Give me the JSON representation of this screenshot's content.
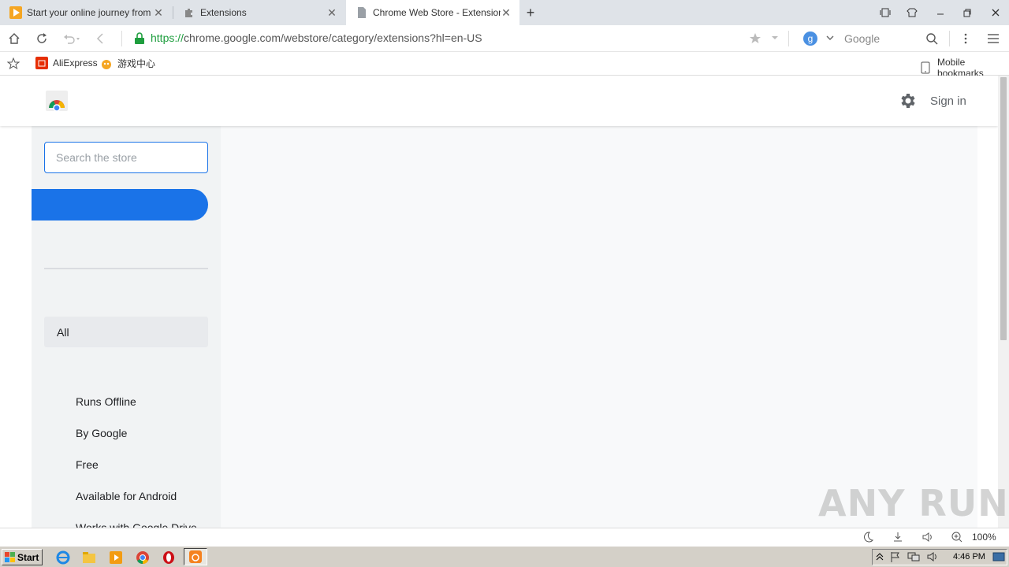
{
  "tabs": [
    {
      "title": "Start your online journey from he",
      "active": false
    },
    {
      "title": "Extensions",
      "active": false
    },
    {
      "title": "Chrome Web Store - Extensions",
      "active": true
    }
  ],
  "address": {
    "url_scheme": "https://",
    "url_rest": "chrome.google.com/webstore/category/extensions?hl=en-US",
    "search_engine": "Google"
  },
  "bookmarks": {
    "items": [
      {
        "label": "AliExpress"
      },
      {
        "label": "游戏中心"
      }
    ],
    "mobile": "Mobile bookmarks"
  },
  "page": {
    "sign_in": "Sign in",
    "search_placeholder": "Search the store",
    "categories": {
      "all": "All"
    },
    "features": [
      "Runs Offline",
      "By Google",
      "Free",
      "Available for Android",
      "Works with Google Drive"
    ]
  },
  "statusbar": {
    "zoom": "100%"
  },
  "watermark": "ANY RUN",
  "taskbar": {
    "start": "Start",
    "clock": "4:46 PM"
  },
  "colors": {
    "accent": "#1a73e8",
    "tab_bar": "#dfe3e8",
    "secure_green": "#1e9e3e"
  }
}
